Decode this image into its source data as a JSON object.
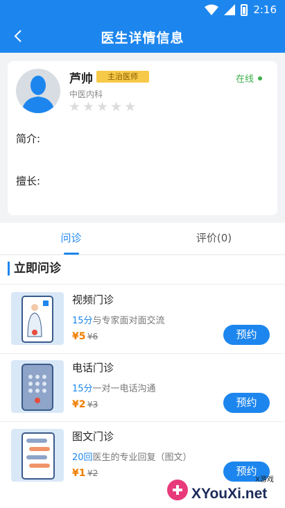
{
  "status": {
    "time": "2:16"
  },
  "header": {
    "title": "医生详情信息"
  },
  "doctor": {
    "name": "芦帅",
    "title_badge": "主治医师",
    "department": "中医内科",
    "rating": 0,
    "status": "在线",
    "intro_label": "简介:",
    "specialty_label": "擅长:"
  },
  "tabs": [
    {
      "label": "问诊"
    },
    {
      "label": "评价(0)"
    }
  ],
  "section": {
    "title": "立即问诊"
  },
  "services": [
    {
      "name": "视频门诊",
      "highlight": "15分",
      "desc": "与专家面对面交流",
      "price": "¥5",
      "old_price": "¥6",
      "button": "预约"
    },
    {
      "name": "电话门诊",
      "highlight": "15分",
      "desc": "一对一电话沟通",
      "price": "¥2",
      "old_price": "¥3",
      "button": "预约"
    },
    {
      "name": "图文门诊",
      "highlight": "20回",
      "desc": "医生的专业回复（图文）",
      "price": "¥1",
      "old_price": "¥2",
      "button": "预约"
    }
  ],
  "watermark": {
    "text": "XYouXi.net",
    "small": "X游戏"
  },
  "colors": {
    "primary": "#1d86ee",
    "price": "#f07d00",
    "online": "#3cb04a",
    "badge": "#f7c948"
  }
}
